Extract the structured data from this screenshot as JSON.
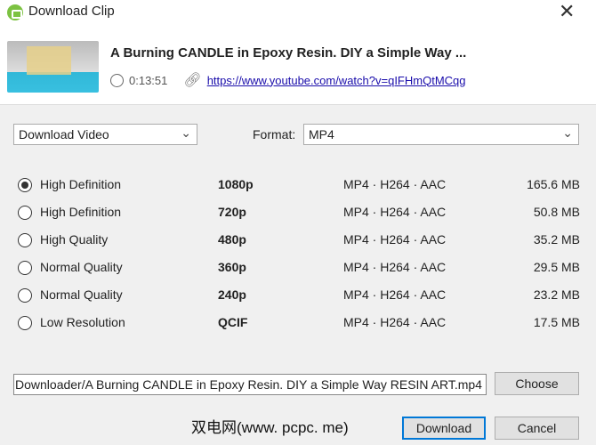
{
  "window": {
    "title": "Download Clip",
    "close": "✕"
  },
  "video": {
    "title": "A Burning CANDLE in Epoxy Resin. DIY a Simple Way ...",
    "duration": "0:13:51",
    "url": "https://www.youtube.com/watch?v=qIFHmQtMCqg"
  },
  "options": {
    "mode": "Download Video",
    "format_label": "Format:",
    "format": "MP4"
  },
  "qualities": [
    {
      "name": "High Definition",
      "res": "1080p",
      "codec": "MP4 · H264 · AAC",
      "size": "165.6 MB",
      "selected": true
    },
    {
      "name": "High Definition",
      "res": "720p",
      "codec": "MP4 · H264 · AAC",
      "size": "50.8 MB",
      "selected": false
    },
    {
      "name": "High Quality",
      "res": "480p",
      "codec": "MP4 · H264 · AAC",
      "size": "35.2 MB",
      "selected": false
    },
    {
      "name": "Normal Quality",
      "res": "360p",
      "codec": "MP4 · H264 · AAC",
      "size": "29.5 MB",
      "selected": false
    },
    {
      "name": "Normal Quality",
      "res": "240p",
      "codec": "MP4 · H264 · AAC",
      "size": "23.2 MB",
      "selected": false
    },
    {
      "name": "Low Resolution",
      "res": "QCIF",
      "codec": "MP4 · H264 · AAC",
      "size": "17.5 MB",
      "selected": false
    }
  ],
  "output": {
    "path": "Downloader/A Burning CANDLE in Epoxy Resin. DIY a Simple Way   RESIN ART.mp4",
    "choose": "Choose"
  },
  "buttons": {
    "download": "Download",
    "cancel": "Cancel"
  },
  "watermark": "双电网(www. pcpc. me)"
}
